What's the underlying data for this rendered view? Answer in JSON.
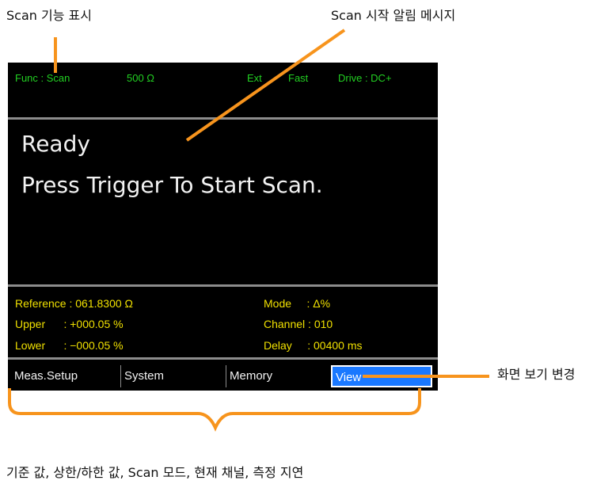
{
  "callouts": {
    "scan_function": "Scan 기능 표시",
    "scan_message": "Scan 시작 알림 메시지",
    "view_change": "화면 보기 변경",
    "info_fields": "기준 값, 상한/하한 값, Scan 모드, 현재 채널, 측정 지연"
  },
  "screen": {
    "status": {
      "func": "Func : Scan",
      "range": "500 Ω",
      "trigger": "Ext",
      "speed": "Fast",
      "drive": "Drive : DC+"
    },
    "message": {
      "line1": "Ready",
      "line2": "Press Trigger To Start Scan."
    },
    "info": {
      "reference": "Reference : 061.8300 Ω",
      "upper": "Upper      : +000.05 %",
      "lower": "Lower      : −000.05 %",
      "mode": "Mode     : Δ%",
      "channel": "Channel : 010",
      "delay": "Delay     : 00400 ms"
    },
    "softkeys": [
      "Meas.Setup",
      "System",
      "Memory",
      "View"
    ]
  },
  "colors": {
    "status_green": "#22d022",
    "info_yellow": "#f0e000",
    "callout_orange": "#f7941d",
    "active_key_blue": "#1a78ff"
  }
}
